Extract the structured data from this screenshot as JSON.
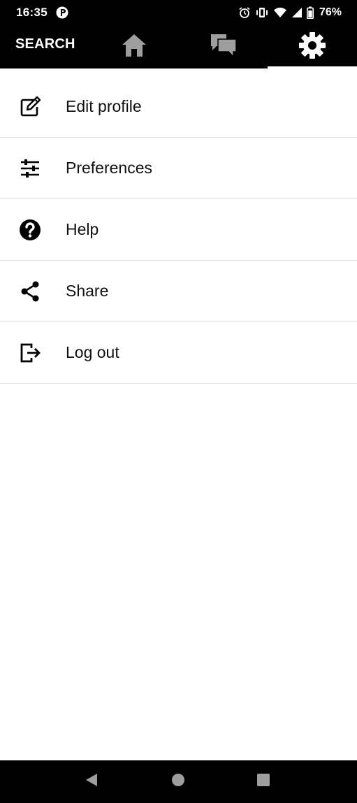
{
  "status_bar": {
    "time": "16:35",
    "app_icon": "app-notification-icon",
    "icons": [
      "alarm-icon",
      "vibrate-icon",
      "wifi-icon",
      "signal-icon",
      "battery-icon"
    ],
    "battery_percent": "76%"
  },
  "top_nav": {
    "search_label": "SEARCH",
    "tabs": [
      {
        "name": "home",
        "icon": "home-icon",
        "active": false
      },
      {
        "name": "chat",
        "icon": "chat-bubbles-icon",
        "active": false
      },
      {
        "name": "settings",
        "icon": "gear-icon",
        "active": true
      }
    ]
  },
  "menu": {
    "items": [
      {
        "label": "Edit profile",
        "icon": "edit-icon"
      },
      {
        "label": "Preferences",
        "icon": "sliders-icon"
      },
      {
        "label": "Help",
        "icon": "help-icon"
      },
      {
        "label": "Share",
        "icon": "share-icon"
      },
      {
        "label": "Log out",
        "icon": "logout-icon"
      }
    ]
  },
  "system_nav": {
    "buttons": [
      "back-icon",
      "home-circle-icon",
      "recents-icon"
    ]
  },
  "colors": {
    "bar_background": "#000000",
    "inactive_icon": "#9e9e9e",
    "active_icon": "#ffffff",
    "divider": "#dedede",
    "text": "#111111"
  }
}
